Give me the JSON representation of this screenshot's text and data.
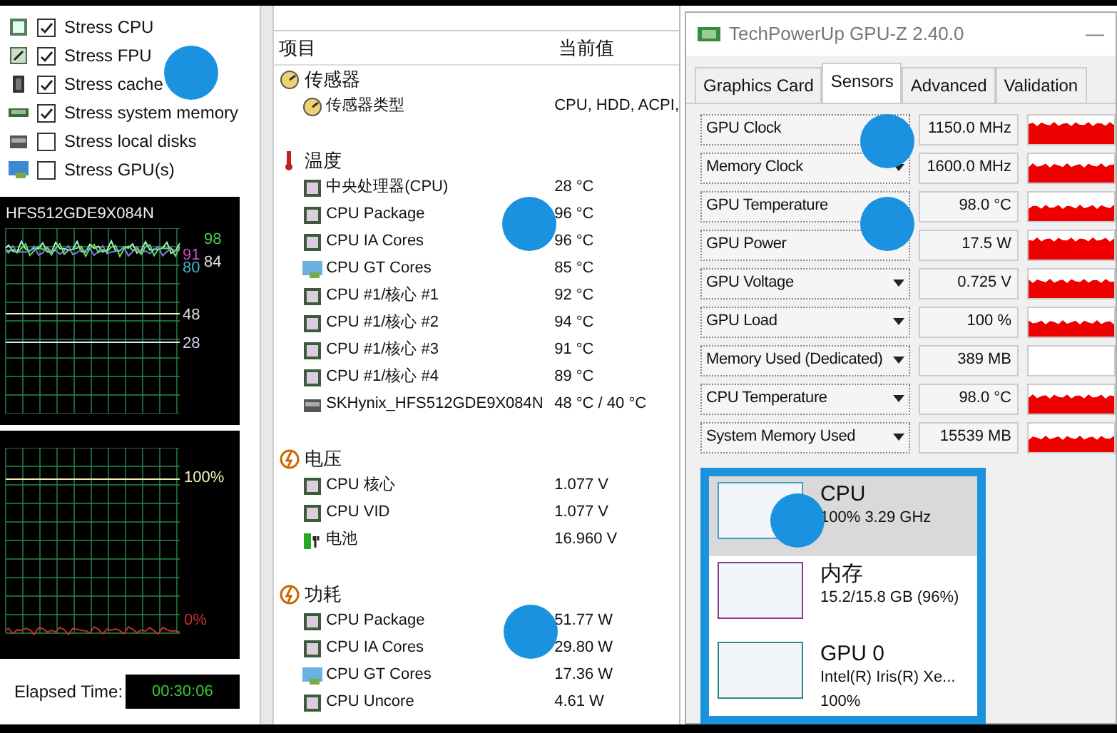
{
  "stress_options": [
    {
      "label": "Stress CPU",
      "checked": true
    },
    {
      "label": "Stress FPU",
      "checked": true
    },
    {
      "label": "Stress cache",
      "checked": true
    },
    {
      "label": "Stress system memory",
      "checked": true
    },
    {
      "label": "Stress local disks",
      "checked": false
    },
    {
      "label": "Stress GPU(s)",
      "checked": false
    }
  ],
  "temperature_chart": {
    "title": "HFS512GDE9X084N",
    "labels": [
      {
        "text": "98",
        "color": "#4ccc4c"
      },
      {
        "text": "91",
        "color": "#c050c0"
      },
      {
        "text": "84",
        "color": "#e0e0e0"
      },
      {
        "text": "80",
        "color": "#40b0d0"
      },
      {
        "text": "48",
        "color": "#e0e0e0"
      },
      {
        "text": "28",
        "color": "#d0d0f0"
      }
    ]
  },
  "usage_chart": {
    "labels": [
      {
        "text": "100%",
        "color": "#f0f0b0"
      },
      {
        "text": "0%",
        "color": "#c03030"
      }
    ]
  },
  "elapsed_time": {
    "label": "Elapsed Time:",
    "value": "00:30:06"
  },
  "sensor_list": {
    "columns": [
      "项目",
      "当前值"
    ],
    "groups": [
      {
        "name": "传感器",
        "items": [
          {
            "name": "传感器类型",
            "value": "CPU, HDD, ACPI,",
            "kind": "sensor"
          }
        ]
      },
      {
        "name": "温度",
        "items": [
          {
            "name": "中央处理器(CPU)",
            "value": "28 °C",
            "kind": "chip"
          },
          {
            "name": "CPU Package",
            "value": "96 °C",
            "kind": "chip"
          },
          {
            "name": "CPU IA Cores",
            "value": "96 °C",
            "kind": "chip"
          },
          {
            "name": "CPU GT Cores",
            "value": "85 °C",
            "kind": "monitor"
          },
          {
            "name": "CPU #1/核心 #1",
            "value": "92 °C",
            "kind": "chip"
          },
          {
            "name": "CPU #1/核心 #2",
            "value": "94 °C",
            "kind": "chip"
          },
          {
            "name": "CPU #1/核心 #3",
            "value": "91 °C",
            "kind": "chip"
          },
          {
            "name": "CPU #1/核心 #4",
            "value": "89 °C",
            "kind": "chip"
          },
          {
            "name": "SKHynix_HFS512GDE9X084N",
            "value": "48 °C / 40 °C",
            "kind": "disk"
          }
        ]
      },
      {
        "name": "电压",
        "items": [
          {
            "name": "CPU 核心",
            "value": "1.077 V",
            "kind": "chip"
          },
          {
            "name": "CPU VID",
            "value": "1.077 V",
            "kind": "chip"
          },
          {
            "name": "电池",
            "value": "16.960 V",
            "kind": "battery"
          }
        ]
      },
      {
        "name": "功耗",
        "items": [
          {
            "name": "CPU Package",
            "value": "51.77 W",
            "kind": "chip"
          },
          {
            "name": "CPU IA Cores",
            "value": "29.80 W",
            "kind": "chip"
          },
          {
            "name": "CPU GT Cores",
            "value": "17.36 W",
            "kind": "monitor"
          },
          {
            "name": "CPU Uncore",
            "value": "4.61 W",
            "kind": "chip"
          }
        ]
      }
    ]
  },
  "gpuz": {
    "title": "TechPowerUp GPU-Z 2.40.0",
    "minimize": "—",
    "tabs": [
      {
        "label": "Graphics Card",
        "selected": false
      },
      {
        "label": "Sensors",
        "selected": true
      },
      {
        "label": "Advanced",
        "selected": false
      },
      {
        "label": "Validation",
        "selected": false
      }
    ],
    "sensors": [
      {
        "name": "GPU Clock",
        "value": "1150.0 MHz",
        "kind": "graph"
      },
      {
        "name": "Memory Clock",
        "value": "1600.0 MHz",
        "kind": "graph"
      },
      {
        "name": "GPU Temperature",
        "value": "98.0 °C",
        "kind": "graph"
      },
      {
        "name": "GPU Power",
        "value": "17.5 W",
        "kind": "graph"
      },
      {
        "name": "GPU Voltage",
        "value": "0.725 V",
        "kind": "graph"
      },
      {
        "name": "GPU Load",
        "value": "100 %",
        "kind": "graph"
      },
      {
        "name": "Memory Used (Dedicated)",
        "value": "389 MB",
        "kind": "empty"
      },
      {
        "name": "CPU Temperature",
        "value": "98.0 °C",
        "kind": "graph"
      },
      {
        "name": "System Memory Used",
        "value": "15539 MB",
        "kind": "graph"
      }
    ]
  },
  "task_manager": [
    {
      "title": "CPU",
      "lines": [
        "100% 3.29 GHz"
      ],
      "selected": true,
      "color": "#4a9cc8"
    },
    {
      "title": "内存",
      "lines": [
        "15.2/15.8 GB (96%)"
      ],
      "selected": false,
      "color": "#8b3a8b"
    },
    {
      "title": "GPU 0",
      "lines": [
        "Intel(R) Iris(R) Xe...",
        "100%"
      ],
      "selected": false,
      "color": "#2a8a8a"
    }
  ]
}
